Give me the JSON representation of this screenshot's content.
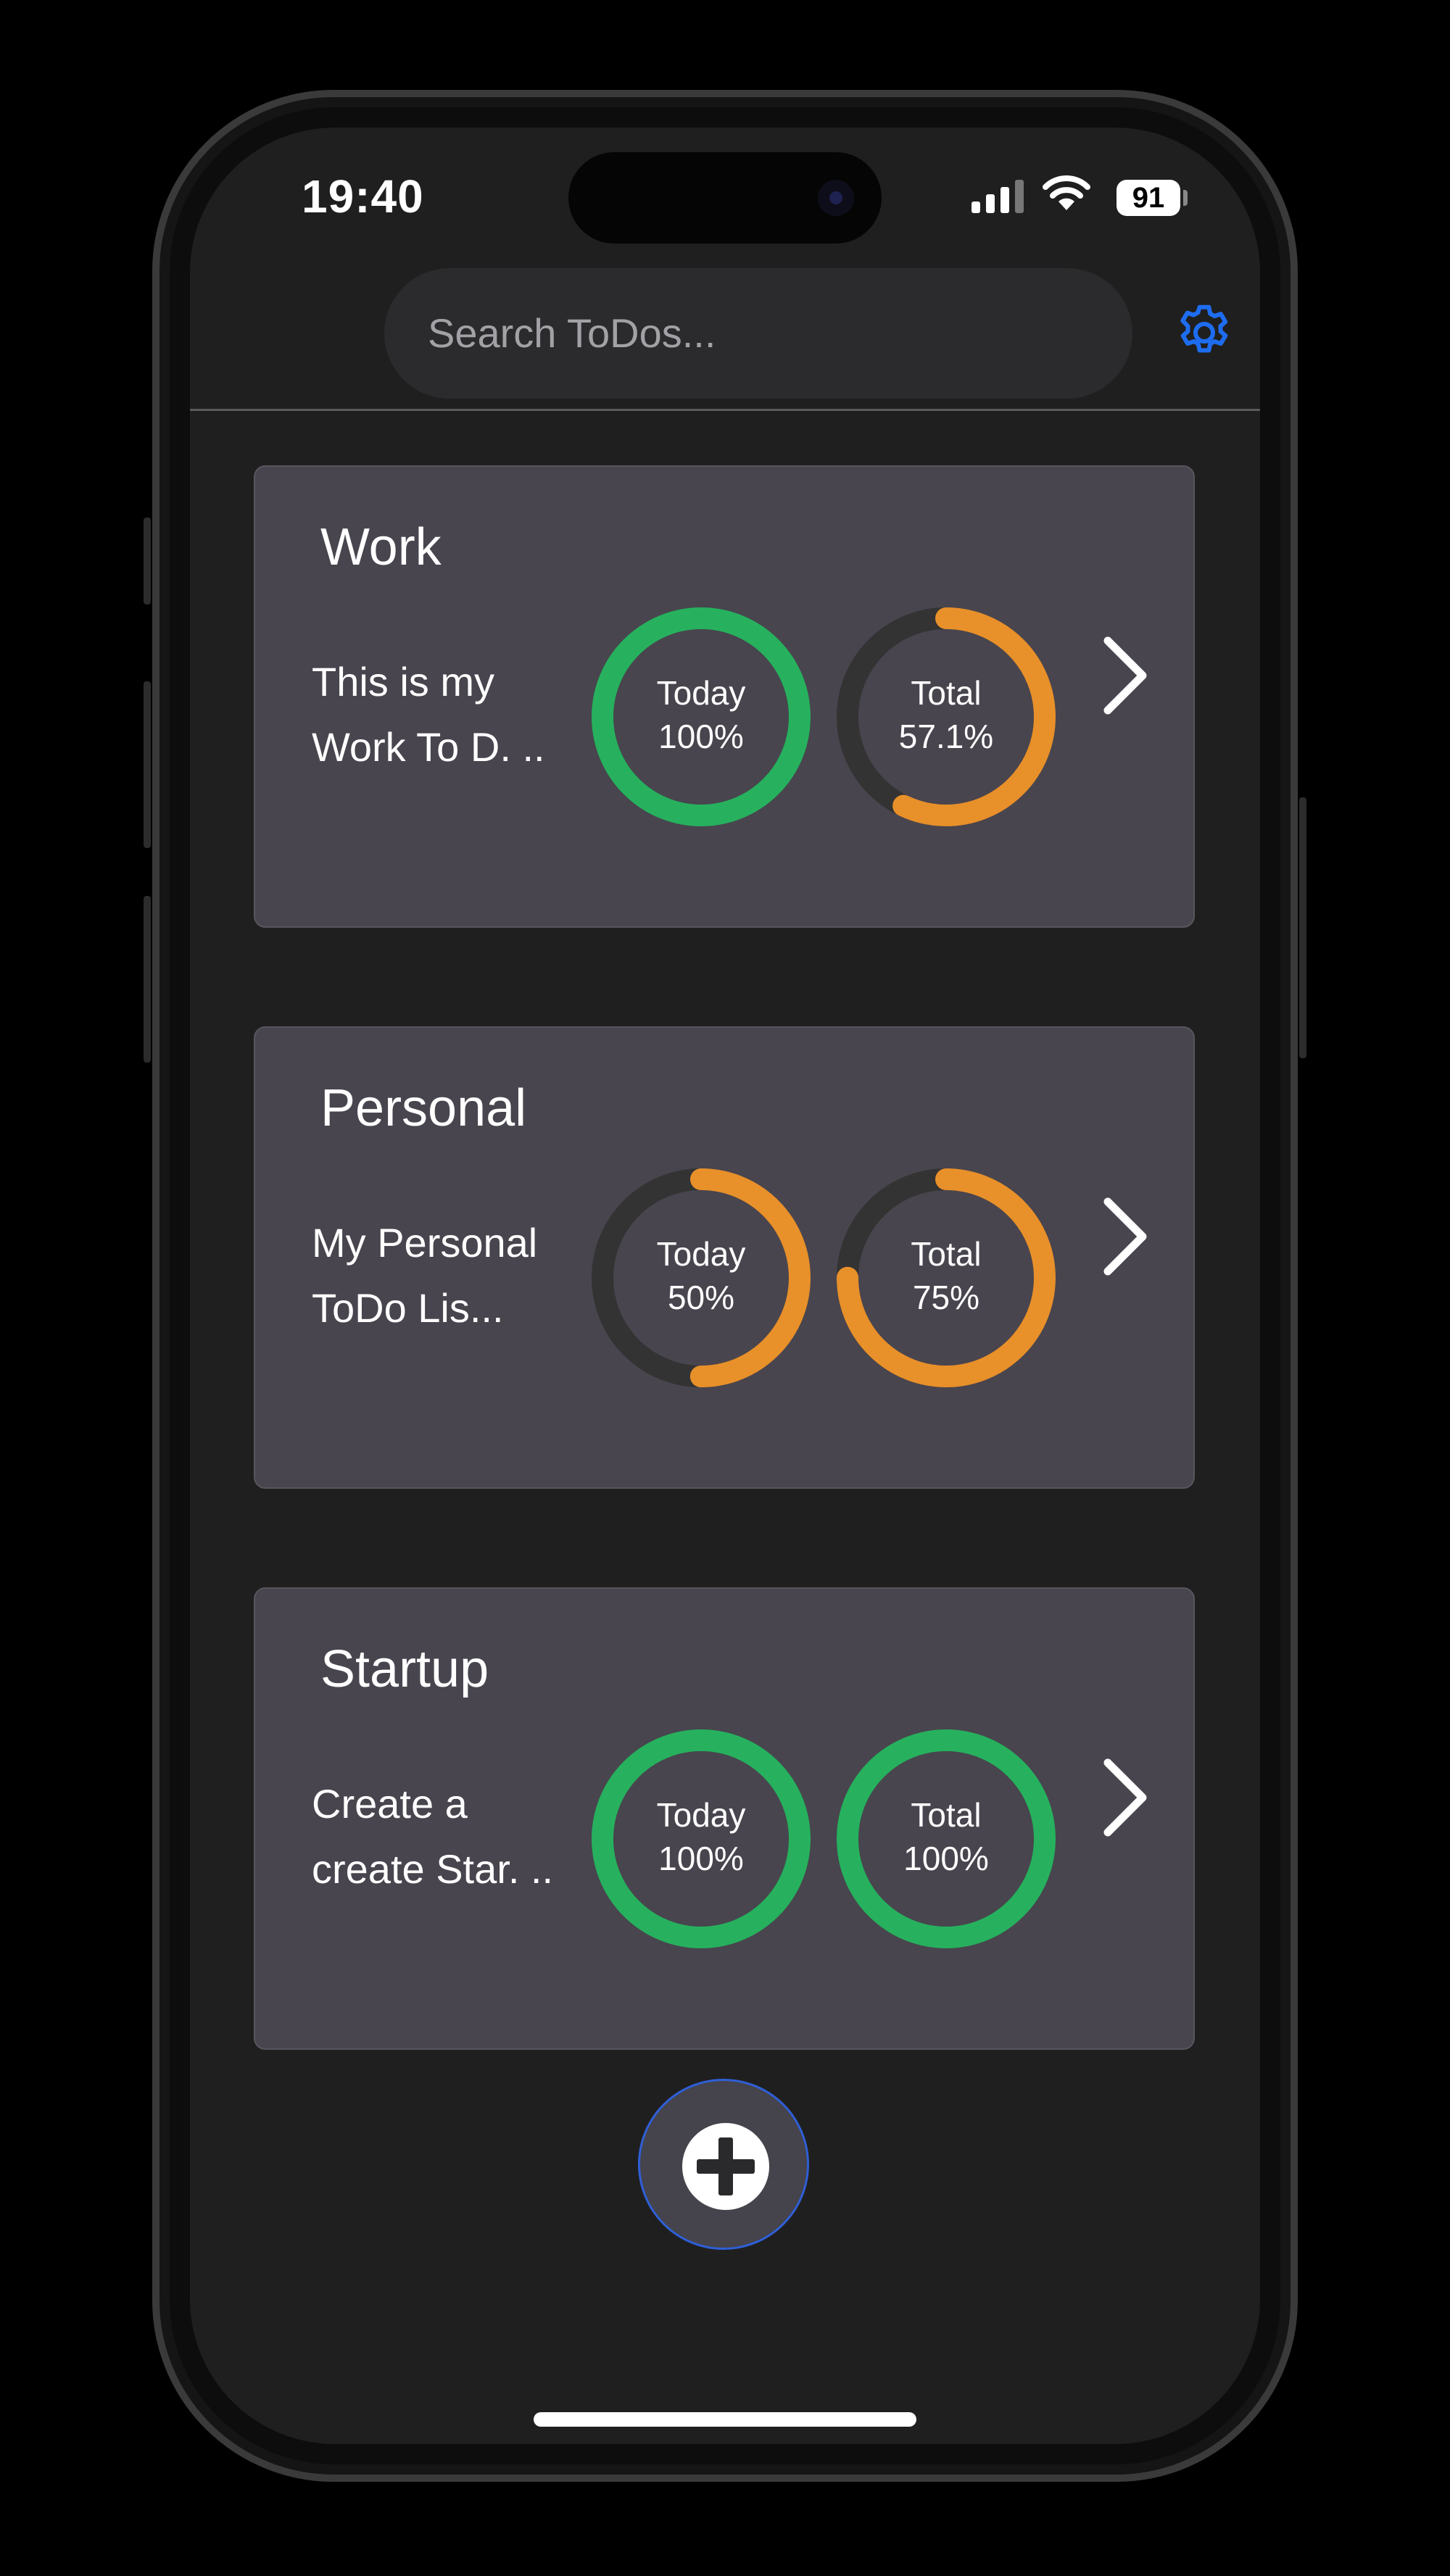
{
  "status_bar": {
    "time": "19:40",
    "battery": "91"
  },
  "search": {
    "placeholder": "Search ToDos..."
  },
  "colors": {
    "complete": "#27b15e",
    "partial": "#e8902a",
    "track": "#333333",
    "accent": "#1e6df0"
  },
  "lists": [
    {
      "title": "Work",
      "description": "This is my Work To D. ..",
      "today": {
        "label": "Today",
        "value": "100%",
        "fraction": 1.0
      },
      "total": {
        "label": "Total",
        "value": "57.1%",
        "fraction": 0.571
      }
    },
    {
      "title": "Personal",
      "description": "My Personal ToDo Lis...",
      "today": {
        "label": "Today",
        "value": "50%",
        "fraction": 0.5
      },
      "total": {
        "label": "Total",
        "value": "75%",
        "fraction": 0.75
      }
    },
    {
      "title": "Startup",
      "description": "Create a create Star. ..",
      "today": {
        "label": "Today",
        "value": "100%",
        "fraction": 1.0
      },
      "total": {
        "label": "Total",
        "value": "100%",
        "fraction": 1.0
      }
    }
  ],
  "icons": {
    "settings": "gear-icon",
    "open_list": "chevron-right-icon",
    "add": "plus-circle-icon"
  }
}
